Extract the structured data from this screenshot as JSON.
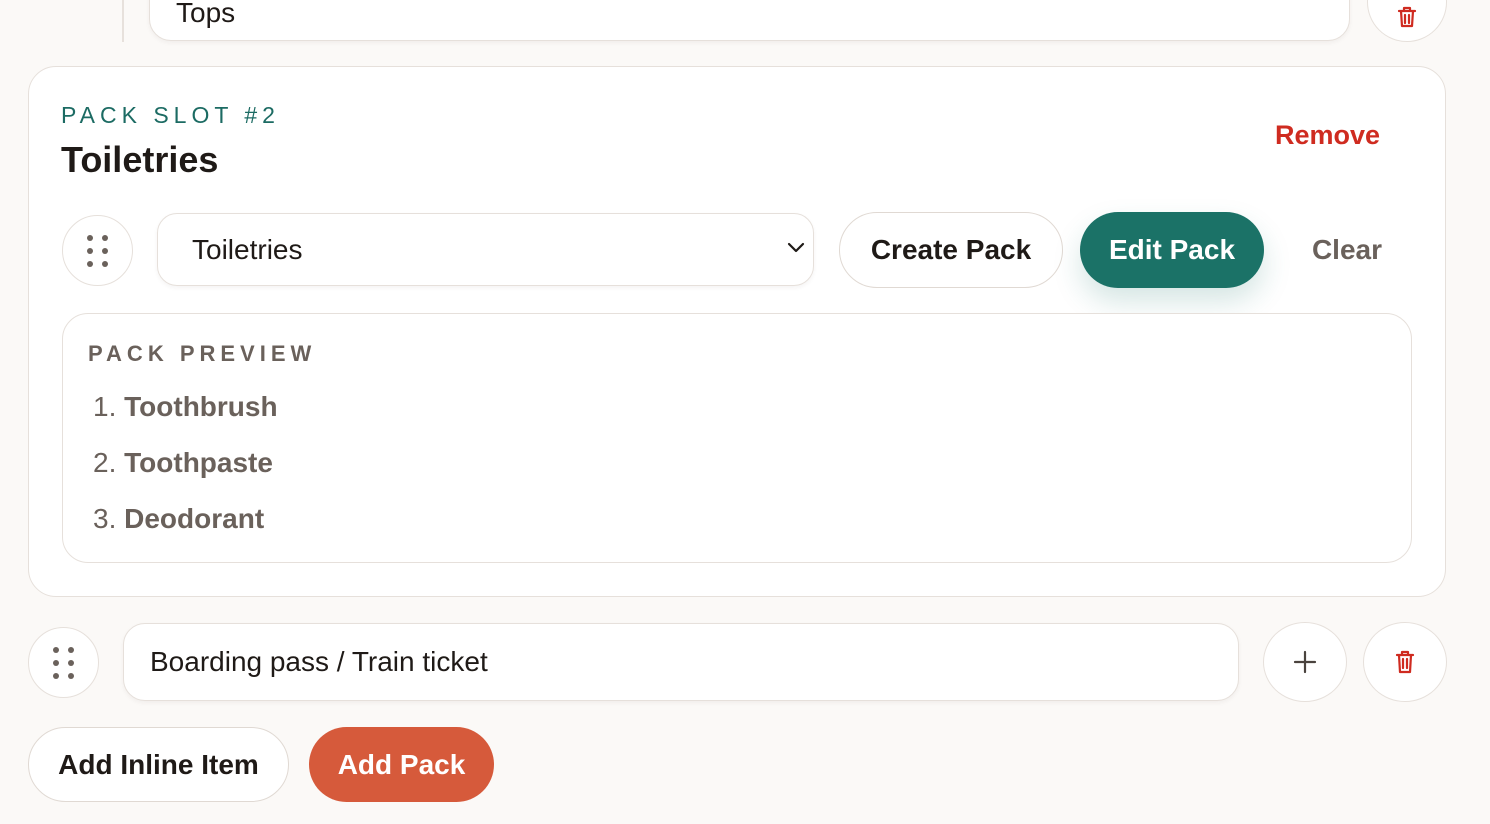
{
  "previous_item": {
    "value": "Tops"
  },
  "pack_slot": {
    "label": "PACK SLOT #2",
    "title": "Toiletries",
    "remove_label": "Remove",
    "selected_pack": "Toiletries",
    "create_label": "Create Pack",
    "edit_label": "Edit Pack",
    "clear_label": "Clear",
    "preview": {
      "label": "PACK PREVIEW",
      "items": [
        {
          "num": "1.",
          "name": "Toothbrush"
        },
        {
          "num": "2.",
          "name": "Toothpaste"
        },
        {
          "num": "3.",
          "name": "Deodorant"
        }
      ]
    }
  },
  "inline_item": {
    "value": "Boarding pass / Train ticket"
  },
  "actions": {
    "add_inline_label": "Add Inline Item",
    "add_pack_label": "Add Pack"
  },
  "colors": {
    "teal": "#1b7267",
    "orange": "#d65a3b",
    "danger": "#cf2b20"
  }
}
